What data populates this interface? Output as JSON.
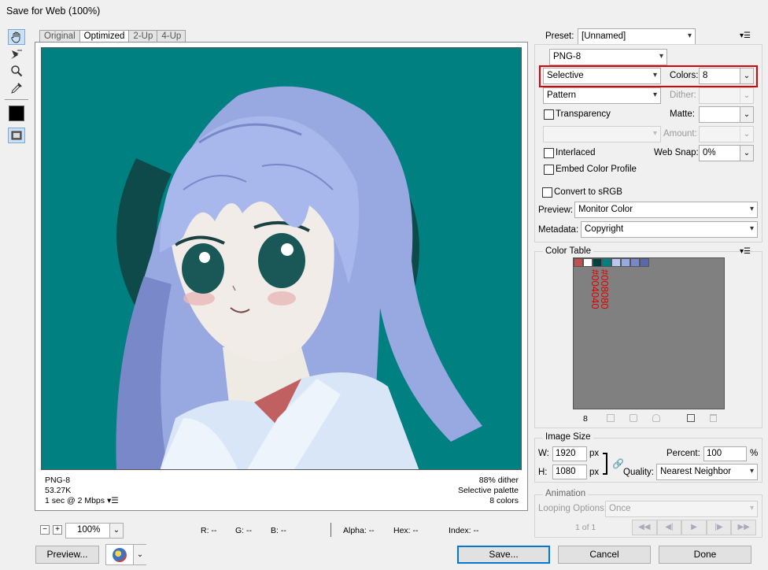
{
  "window": {
    "title": "Save for Web (100%)"
  },
  "tools": [
    "hand-tool-icon",
    "slice-select-tool-icon",
    "zoom-tool-icon",
    "eyedropper-tool-icon"
  ],
  "tabs": [
    {
      "label": "Original"
    },
    {
      "label": "Optimized"
    },
    {
      "label": "2-Up"
    },
    {
      "label": "4-Up"
    }
  ],
  "info": {
    "format": "PNG-8",
    "size": "53.27K",
    "speed": "1 sec @ 2 Mbps",
    "dither": "88% dither",
    "palette": "Selective palette",
    "colors": "8 colors"
  },
  "settings": {
    "preset_label": "Preset:",
    "preset_value": "[Unnamed]",
    "format_value": "PNG-8",
    "reduction_value": "Selective",
    "colors_label": "Colors:",
    "colors_value": "8",
    "dither_method_value": "Pattern",
    "dither_label": "Dither:",
    "transparency_label": "Transparency",
    "matte_label": "Matte:",
    "amount_label": "Amount:",
    "interlaced_label": "Interlaced",
    "websnap_label": "Web Snap:",
    "websnap_value": "0%",
    "embed_label": "Embed Color Profile",
    "convert_label": "Convert to sRGB",
    "preview_label": "Preview:",
    "preview_value": "Monitor Color",
    "metadata_label": "Metadata:",
    "metadata_value": "Copyright"
  },
  "color_table": {
    "title": "Color Table",
    "swatches": [
      "#c05050",
      "#ffffff",
      "#004040",
      "#008080",
      "#b8c8f0",
      "#98a8e0",
      "#7888c8",
      "#5868a8"
    ],
    "annotation_1": "#008080",
    "annotation_2": "#004040",
    "count": "8"
  },
  "image_size": {
    "title": "Image Size",
    "w_label": "W:",
    "w_value": "1920",
    "h_label": "H:",
    "h_value": "1080",
    "unit": "px",
    "percent_label": "Percent:",
    "percent_value": "100",
    "percent_unit": "%",
    "quality_label": "Quality:",
    "quality_value": "Nearest Neighbor"
  },
  "animation": {
    "title": "Animation",
    "looping_label": "Looping Options:",
    "looping_value": "Once",
    "frame_counter": "1 of 1"
  },
  "status_bar": {
    "zoom_value": "100%",
    "r": "R: --",
    "g": "G: --",
    "b": "B: --",
    "alpha": "Alpha: --",
    "hex": "Hex: --",
    "index": "Index: --"
  },
  "buttons": {
    "preview": "Preview...",
    "save": "Save...",
    "cancel": "Cancel",
    "done": "Done"
  },
  "colors": {
    "highlight": "#e00000",
    "teal": "#008080",
    "accent": "#0078d7"
  }
}
